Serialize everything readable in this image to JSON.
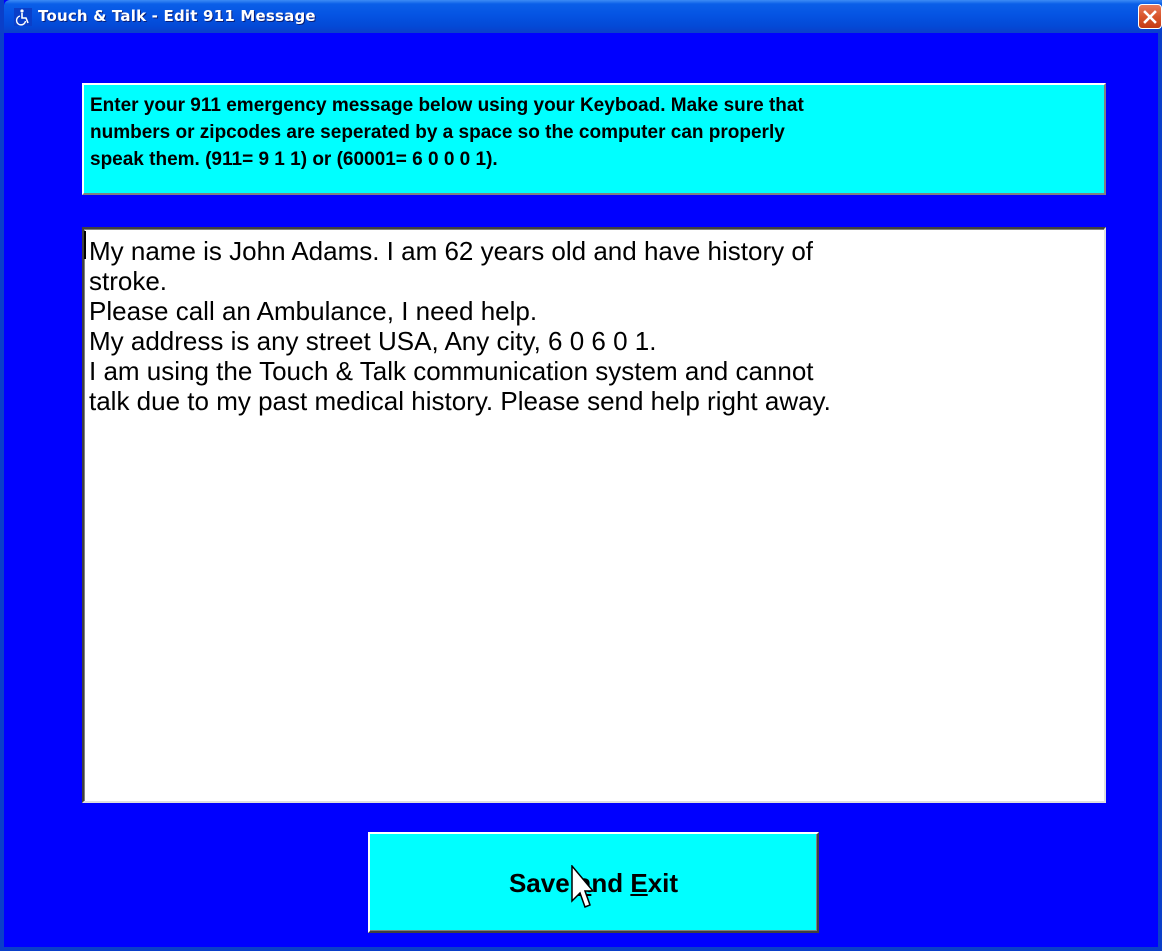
{
  "window": {
    "title": "Touch & Talk - Edit 911 Message",
    "title_icon": "wheelchair-icon",
    "close_icon": "close-icon"
  },
  "instructions": {
    "text": "Enter your 911 emergency message below using your Keyboad. Make sure that\nnumbers or zipcodes are seperated by a space so the computer can properly\nspeak them. (911= 9 1 1) or (60001= 6 0 0 0 1)."
  },
  "message": {
    "value": "My name is John Adams. I am 62 years old and have history of\nstroke.\nPlease call an Ambulance, I need help.\nMy address is any street USA, Any city, 6 0 6 0 1.\nI am using the Touch & Talk communication system and cannot\ntalk due to my past medical history. Please send help right away."
  },
  "save_button": {
    "label_before": "Save ",
    "label_mnemonic_a": "a",
    "label_middle": "nd ",
    "label_mnemonic_e": "E",
    "label_after": "xit"
  },
  "colors": {
    "background": "#0000ff",
    "panel": "#00ffff",
    "titlebar": "#0554e3",
    "close": "#d9542b"
  }
}
